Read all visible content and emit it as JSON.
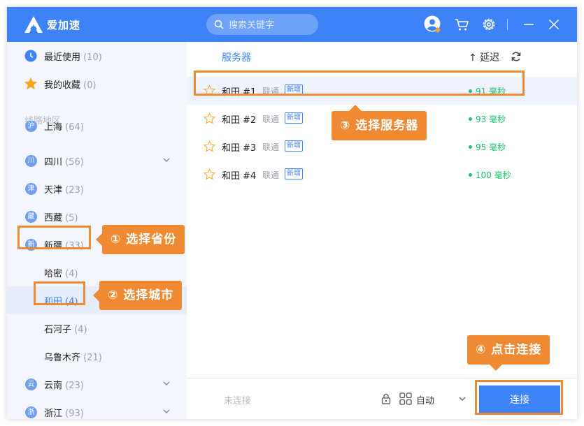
{
  "app": {
    "brand": "爱加速",
    "search_placeholder": "搜索关键字"
  },
  "sidebar": {
    "top_items": [
      {
        "label": "最近使用",
        "count": "(10)",
        "icon": "clock-icon"
      },
      {
        "label": "我的收藏",
        "count": "(0)",
        "icon": "star-icon"
      }
    ],
    "section_label": "线路地区",
    "regions": [
      {
        "glyph": "沪",
        "label": "上海",
        "count": "(64)"
      },
      {
        "glyph": "川",
        "label": "四川",
        "count": "(56)"
      },
      {
        "glyph": "津",
        "label": "天津",
        "count": "(23)"
      },
      {
        "glyph": "藏",
        "label": "西藏",
        "count": "(5)"
      },
      {
        "glyph": "新",
        "label": "新疆",
        "count": "(33)"
      }
    ],
    "cities": [
      {
        "label": "哈密",
        "count": "(4)"
      },
      {
        "label": "和田",
        "count": "(4)"
      },
      {
        "label": "石河子",
        "count": "(4)"
      },
      {
        "label": "乌鲁木齐",
        "count": "(21)"
      }
    ],
    "bottom_regions": [
      {
        "glyph": "云",
        "label": "云南",
        "count": "(23)"
      },
      {
        "glyph": "浙",
        "label": "浙江",
        "count": "(93)"
      }
    ]
  },
  "main": {
    "header_servers": "服务器",
    "header_latency": "↑ 延迟",
    "servers": [
      {
        "name": "和田 #1",
        "isp": "联通",
        "badge": "新增",
        "latency": "91 毫秒"
      },
      {
        "name": "和田 #2",
        "isp": "联通",
        "badge": "新增",
        "latency": "93 毫秒"
      },
      {
        "name": "和田 #3",
        "isp": "联通",
        "badge": "新增",
        "latency": "95 毫秒"
      },
      {
        "name": "和田 #4",
        "isp": "联通",
        "badge": "新增",
        "latency": "100 毫秒"
      }
    ],
    "footer": {
      "status": "未连接",
      "mode": "自动",
      "connect_label": "连接"
    }
  },
  "callouts": {
    "step1": "① 选择省份",
    "step2": "② 选择城市",
    "step3": "③ 选择服务器",
    "step4": "④ 点击连接"
  },
  "colors": {
    "accent": "#3d82f7",
    "callout": "#ef8a32",
    "latency": "#1ebf6b"
  }
}
